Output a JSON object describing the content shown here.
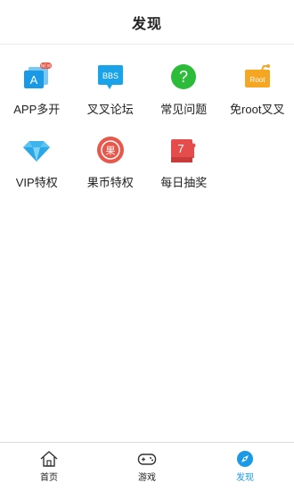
{
  "header": {
    "title": "发现"
  },
  "grid": {
    "items": [
      {
        "label": "APP多开",
        "icon": "app-multi-icon",
        "badge": "NEW",
        "icon_text": "A"
      },
      {
        "label": "叉叉论坛",
        "icon": "bbs-forum-icon",
        "icon_text": "BBS"
      },
      {
        "label": "常见问题",
        "icon": "question-icon",
        "icon_text": "?"
      },
      {
        "label": "免root叉叉",
        "icon": "root-free-icon",
        "icon_text": "Root"
      },
      {
        "label": "VIP特权",
        "icon": "diamond-icon"
      },
      {
        "label": "果币特权",
        "icon": "coin-icon",
        "icon_text": "果"
      },
      {
        "label": "每日抽奖",
        "icon": "lottery-icon",
        "icon_text": "7"
      }
    ]
  },
  "tabbar": {
    "tabs": [
      {
        "label": "首页",
        "icon": "home-icon"
      },
      {
        "label": "游戏",
        "icon": "gamepad-icon"
      },
      {
        "label": "发现",
        "icon": "compass-icon",
        "active": true
      }
    ]
  },
  "colors": {
    "accent": "#1a9ae6",
    "red": "#e54c3c",
    "green": "#2dbb3a",
    "orange": "#f5a623"
  }
}
